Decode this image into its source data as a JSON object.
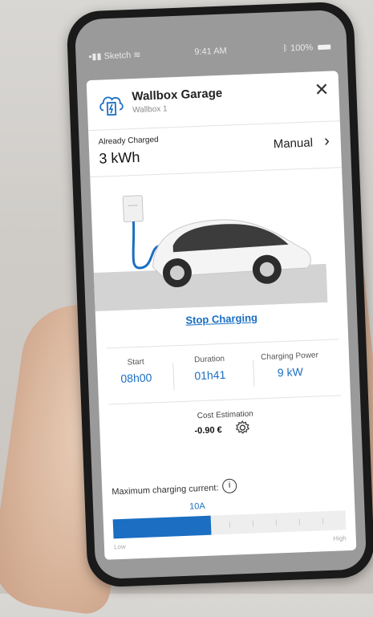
{
  "status_bar": {
    "carrier": "Sketch",
    "time": "9:41 AM",
    "battery": "100%"
  },
  "header": {
    "title": "Wallbox Garage",
    "subtitle": "Wallbox 1",
    "close_label": "✕"
  },
  "charge": {
    "label": "Already Charged",
    "value": "3 kWh",
    "mode": "Manual",
    "mode_chevron": "›"
  },
  "actions": {
    "stop_charging": "Stop Charging"
  },
  "stats": [
    {
      "label": "Start",
      "value": "08h00"
    },
    {
      "label": "Duration",
      "value": "01h41"
    },
    {
      "label": "Charging Power",
      "value": "9 kW"
    }
  ],
  "cost": {
    "label": "Cost Estimation",
    "value": "-0.90 €"
  },
  "current": {
    "label": "Maximum charging current:",
    "info_icon": "i",
    "value": "10A",
    "level": 0.42,
    "low_label": "Low",
    "high_label": "High"
  },
  "colors": {
    "accent": "#1b6ec2",
    "screen_bg": "#9a9a9a",
    "card_bg": "#ffffff"
  },
  "icons": {
    "logo": "wallbox-charger-icon",
    "close": "close-icon",
    "settings": "gear-icon",
    "info": "info-icon"
  }
}
